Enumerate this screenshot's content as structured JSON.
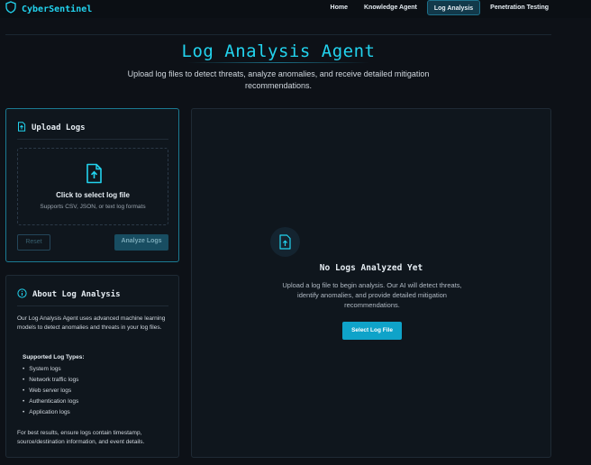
{
  "app": {
    "name": "CyberSentinel",
    "logo_icon": "shield-icon"
  },
  "nav": {
    "items": [
      {
        "label": "Home",
        "active": false
      },
      {
        "label": "Knowledge Agent",
        "active": false
      },
      {
        "label": "Log Analysis",
        "active": true
      },
      {
        "label": "Penetration Testing",
        "active": false
      }
    ]
  },
  "page": {
    "title": "Log Analysis Agent",
    "subtitle": "Upload log files to detect threats, analyze anomalies, and receive detailed mitigation recommendations."
  },
  "upload": {
    "title": "Upload Logs",
    "icon": "file-upload-icon",
    "dropzone_title": "Click to select log file",
    "dropzone_hint": "Supports CSV, JSON, or text log formats",
    "reset_label": "Reset",
    "analyze_label": "Analyze Logs"
  },
  "about": {
    "title": "About Log Analysis",
    "icon": "info-icon",
    "intro": "Our Log Analysis Agent uses advanced machine learning models to detect anomalies and threats in your log files.",
    "types_title": "Supported Log Types:",
    "types": [
      "System logs",
      "Network traffic logs",
      "Web server logs",
      "Authentication logs",
      "Application logs"
    ],
    "footer": "For best results, ensure logs contain timestamp, source/destination information, and event details."
  },
  "results": {
    "empty_title": "No Logs Analyzed Yet",
    "empty_text": "Upload a log file to begin analysis. Our AI will detect threats, identify anomalies, and provide detailed mitigation recommendations.",
    "select_label": "Select Log File"
  },
  "colors": {
    "accent": "#22d3ee",
    "background": "#0d1117",
    "card": "#0f161d",
    "button": "#0fa3c9"
  }
}
